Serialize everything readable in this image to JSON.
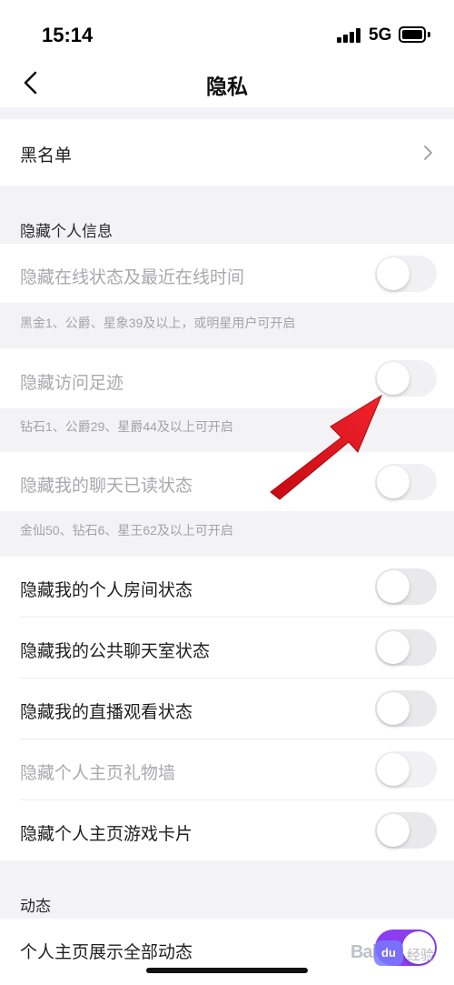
{
  "status_bar": {
    "time": "15:14",
    "network": "5G",
    "battery_level": 0.9
  },
  "nav": {
    "title": "隐私",
    "back_icon": "chevron-left-icon"
  },
  "blacklist": {
    "label": "黑名单",
    "icon": "chevron-right-icon"
  },
  "sections": {
    "hide_info": {
      "header": "隐藏个人信息",
      "items": [
        {
          "label": "隐藏在线状态及最近在线时间",
          "enabled": false,
          "on": false,
          "hint": "黑金1、公爵、星象39及以上，或明星用户可开启"
        },
        {
          "label": "隐藏访问足迹",
          "enabled": false,
          "on": false,
          "hint": "钻石1、公爵29、星爵44及以上可开启"
        },
        {
          "label": "隐藏我的聊天已读状态",
          "enabled": false,
          "on": false,
          "hint": "金仙50、钻石6、星王62及以上可开启"
        },
        {
          "label": "隐藏我的个人房间状态",
          "enabled": true,
          "on": false
        },
        {
          "label": "隐藏我的公共聊天室状态",
          "enabled": true,
          "on": false
        },
        {
          "label": "隐藏我的直播观看状态",
          "enabled": true,
          "on": false
        },
        {
          "label": "隐藏个人主页礼物墙",
          "enabled": false,
          "on": false
        },
        {
          "label": "隐藏个人主页游戏卡片",
          "enabled": true,
          "on": false
        }
      ]
    },
    "dynamic": {
      "header": "动态",
      "items": [
        {
          "label": "个人主页展示全部动态",
          "enabled": true,
          "on": true
        }
      ]
    }
  },
  "colors": {
    "accent": "#8b3df2",
    "annotation_arrow": "#e8141c"
  },
  "watermark": {
    "text": "Bai",
    "badge": "du",
    "suffix": "经验"
  }
}
